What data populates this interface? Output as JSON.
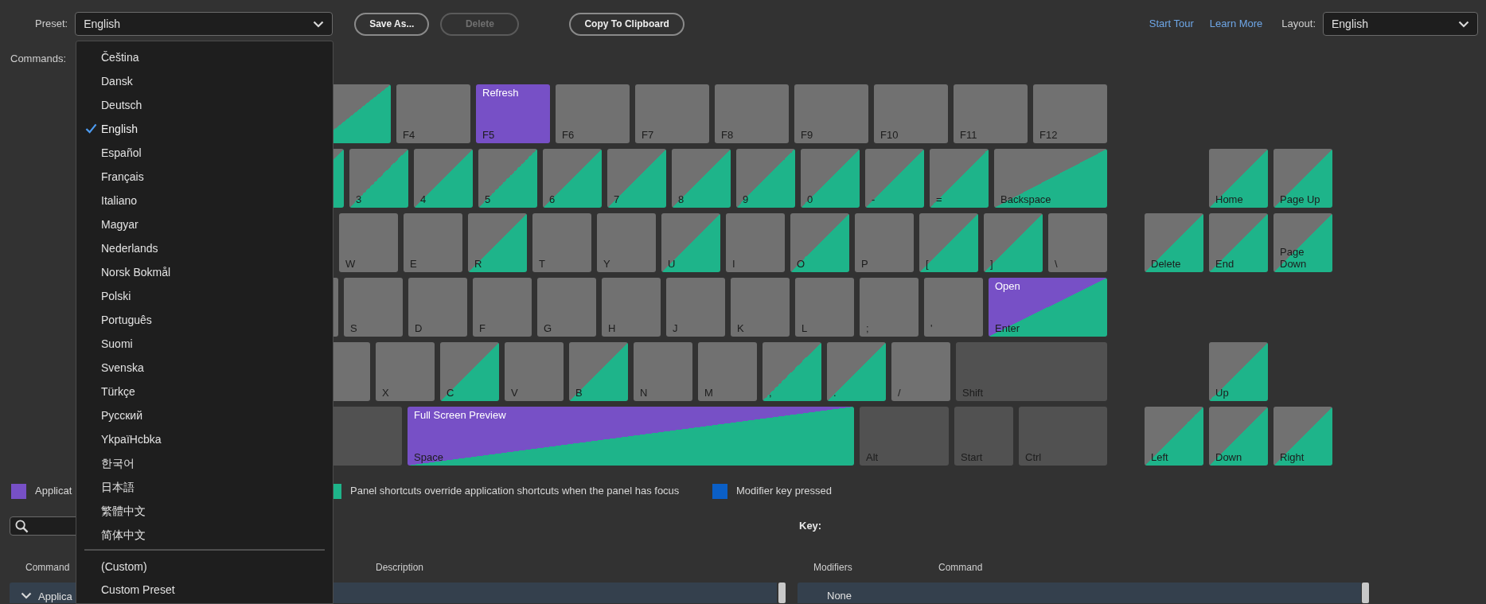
{
  "toolbar": {
    "preset_label": "Preset:",
    "preset_value": "English",
    "buttons": [
      {
        "label": "Save As...",
        "disabled": false
      },
      {
        "label": "Delete",
        "disabled": true
      },
      {
        "label": "Copy To Clipboard",
        "disabled": false
      }
    ],
    "links": [
      "Start Tour",
      "Learn More"
    ],
    "layout_label": "Layout:",
    "layout_value": "English"
  },
  "commands_label": "Commands:",
  "keyboard": {
    "rows": [
      {
        "keys": [
          {
            "kind": "key",
            "app_shortcut": false,
            "panel_shortcut": true
          },
          {
            "kind": "key",
            "label": "F4",
            "app_shortcut": false,
            "panel_shortcut": false
          },
          {
            "kind": "key",
            "label": "F5",
            "command": "Refresh",
            "app_shortcut": true,
            "panel_shortcut": false
          },
          {
            "kind": "key",
            "label": "F6",
            "app_shortcut": false,
            "panel_shortcut": false
          },
          {
            "kind": "key",
            "label": "F7",
            "app_shortcut": false,
            "panel_shortcut": false
          },
          {
            "kind": "key",
            "label": "F8",
            "app_shortcut": false,
            "panel_shortcut": false
          },
          {
            "kind": "key",
            "label": "F9",
            "app_shortcut": false,
            "panel_shortcut": false
          },
          {
            "kind": "key",
            "label": "F10",
            "app_shortcut": false,
            "panel_shortcut": false
          },
          {
            "kind": "key",
            "label": "F11",
            "app_shortcut": false,
            "panel_shortcut": false
          },
          {
            "kind": "key",
            "label": "F12",
            "app_shortcut": false,
            "panel_shortcut": false
          }
        ],
        "nav_keys": []
      },
      {
        "keys": [
          {
            "kind": "key",
            "app_shortcut": false,
            "panel_shortcut": true
          },
          {
            "kind": "key",
            "label": "3",
            "app_shortcut": false,
            "panel_shortcut": true
          },
          {
            "kind": "key",
            "label": "4",
            "app_shortcut": false,
            "panel_shortcut": true
          },
          {
            "kind": "key",
            "label": "5",
            "app_shortcut": false,
            "panel_shortcut": true
          },
          {
            "kind": "key",
            "label": "6",
            "app_shortcut": false,
            "panel_shortcut": true
          },
          {
            "kind": "key",
            "label": "7",
            "app_shortcut": false,
            "panel_shortcut": true
          },
          {
            "kind": "key",
            "label": "8",
            "app_shortcut": false,
            "panel_shortcut": true
          },
          {
            "kind": "key",
            "label": "9",
            "app_shortcut": false,
            "panel_shortcut": true
          },
          {
            "kind": "key",
            "label": "0",
            "app_shortcut": false,
            "panel_shortcut": true
          },
          {
            "kind": "key",
            "label": "-",
            "app_shortcut": false,
            "panel_shortcut": true
          },
          {
            "kind": "key",
            "label": "=",
            "app_shortcut": false,
            "panel_shortcut": true
          },
          {
            "kind": "key",
            "label": "Backspace",
            "app_shortcut": false,
            "panel_shortcut": true
          }
        ],
        "nav_keys": [
          {
            "kind": "key",
            "label": "Home",
            "app_shortcut": false,
            "panel_shortcut": true
          },
          {
            "kind": "key",
            "label": "Page Up",
            "app_shortcut": false,
            "panel_shortcut": true
          }
        ]
      },
      {
        "keys": [
          {
            "kind": "key",
            "label": "W",
            "app_shortcut": false,
            "panel_shortcut": false
          },
          {
            "kind": "key",
            "label": "E",
            "app_shortcut": false,
            "panel_shortcut": false
          },
          {
            "kind": "key",
            "label": "R",
            "app_shortcut": false,
            "panel_shortcut": true
          },
          {
            "kind": "key",
            "label": "T",
            "app_shortcut": false,
            "panel_shortcut": false
          },
          {
            "kind": "key",
            "label": "Y",
            "app_shortcut": false,
            "panel_shortcut": false
          },
          {
            "kind": "key",
            "label": "U",
            "app_shortcut": false,
            "panel_shortcut": true
          },
          {
            "kind": "key",
            "label": "I",
            "app_shortcut": false,
            "panel_shortcut": false
          },
          {
            "kind": "key",
            "label": "O",
            "app_shortcut": false,
            "panel_shortcut": true
          },
          {
            "kind": "key",
            "label": "P",
            "app_shortcut": false,
            "panel_shortcut": false
          },
          {
            "kind": "key",
            "label": "[",
            "app_shortcut": false,
            "panel_shortcut": true
          },
          {
            "kind": "key",
            "label": "]",
            "app_shortcut": false,
            "panel_shortcut": true
          },
          {
            "kind": "key",
            "label": "\\",
            "app_shortcut": false,
            "panel_shortcut": false
          }
        ],
        "nav_keys": [
          {
            "kind": "key",
            "label": "Delete",
            "app_shortcut": false,
            "panel_shortcut": true
          },
          {
            "kind": "key",
            "label": "End",
            "app_shortcut": false,
            "panel_shortcut": true
          },
          {
            "kind": "key",
            "label": "Page Down",
            "app_shortcut": false,
            "panel_shortcut": true
          }
        ]
      },
      {
        "keys": [
          {
            "kind": "key",
            "app_shortcut": false,
            "panel_shortcut": false
          },
          {
            "kind": "key",
            "label": "S",
            "app_shortcut": false,
            "panel_shortcut": false
          },
          {
            "kind": "key",
            "label": "D",
            "app_shortcut": false,
            "panel_shortcut": false
          },
          {
            "kind": "key",
            "label": "F",
            "app_shortcut": false,
            "panel_shortcut": false
          },
          {
            "kind": "key",
            "label": "G",
            "app_shortcut": false,
            "panel_shortcut": false
          },
          {
            "kind": "key",
            "label": "H",
            "app_shortcut": false,
            "panel_shortcut": false
          },
          {
            "kind": "key",
            "label": "J",
            "app_shortcut": false,
            "panel_shortcut": false
          },
          {
            "kind": "key",
            "label": "K",
            "app_shortcut": false,
            "panel_shortcut": false
          },
          {
            "kind": "key",
            "label": "L",
            "app_shortcut": false,
            "panel_shortcut": false
          },
          {
            "kind": "key",
            "label": ";",
            "app_shortcut": false,
            "panel_shortcut": false
          },
          {
            "kind": "key",
            "label": "'",
            "app_shortcut": false,
            "panel_shortcut": false
          },
          {
            "kind": "key",
            "label": "Enter",
            "command": "Open",
            "app_shortcut": true,
            "panel_shortcut": true
          }
        ],
        "nav_keys": []
      },
      {
        "keys": [
          {
            "kind": "key",
            "app_shortcut": false,
            "panel_shortcut": false
          },
          {
            "kind": "key",
            "label": "X",
            "app_shortcut": false,
            "panel_shortcut": false
          },
          {
            "kind": "key",
            "label": "C",
            "app_shortcut": false,
            "panel_shortcut": true
          },
          {
            "kind": "key",
            "label": "V",
            "app_shortcut": false,
            "panel_shortcut": false
          },
          {
            "kind": "key",
            "label": "B",
            "app_shortcut": false,
            "panel_shortcut": true
          },
          {
            "kind": "key",
            "label": "N",
            "app_shortcut": false,
            "panel_shortcut": false
          },
          {
            "kind": "key",
            "label": "M",
            "app_shortcut": false,
            "panel_shortcut": false
          },
          {
            "kind": "key",
            "label": ",",
            "app_shortcut": false,
            "panel_shortcut": true
          },
          {
            "kind": "key",
            "label": ".",
            "app_shortcut": false,
            "panel_shortcut": true
          },
          {
            "kind": "key",
            "label": "/",
            "app_shortcut": false,
            "panel_shortcut": false
          },
          {
            "kind": "modifier",
            "label": "Shift"
          }
        ],
        "nav_keys": [
          {
            "kind": "key",
            "label": "Up",
            "app_shortcut": false,
            "panel_shortcut": true
          }
        ]
      },
      {
        "keys": [
          {
            "kind": "modifier"
          },
          {
            "kind": "key",
            "label": "Space",
            "command": "Full Screen Preview",
            "app_shortcut": true,
            "panel_shortcut": true
          },
          {
            "kind": "modifier",
            "label": "Alt"
          },
          {
            "kind": "modifier",
            "label": "Start"
          },
          {
            "kind": "modifier",
            "label": "Ctrl"
          }
        ],
        "nav_keys": [
          {
            "kind": "key",
            "label": "Left",
            "app_shortcut": false,
            "panel_shortcut": true
          },
          {
            "kind": "key",
            "label": "Down",
            "app_shortcut": false,
            "panel_shortcut": true
          },
          {
            "kind": "key",
            "label": "Right",
            "app_shortcut": false,
            "panel_shortcut": true
          }
        ]
      }
    ]
  },
  "legend": [
    {
      "label": "Applicat",
      "color": "#7750c6"
    },
    {
      "label": "Panel shortcuts override application shortcuts when the panel has focus",
      "color": "#1eb48a"
    },
    {
      "label": "Modifier key pressed",
      "color": "#0b5fc6"
    }
  ],
  "key_label": "Key:",
  "commands_table": {
    "columns": [
      "Command",
      "Description"
    ],
    "rows": [
      {
        "label": "Applica",
        "expanded": true
      }
    ]
  },
  "keys_table": {
    "columns": [
      "Modifiers",
      "Command"
    ],
    "rows": [
      {
        "modifiers": "None"
      }
    ]
  },
  "preset_menu": {
    "items": [
      {
        "label": "Čeština",
        "selected": false
      },
      {
        "label": "Dansk",
        "selected": false
      },
      {
        "label": "Deutsch",
        "selected": false
      },
      {
        "label": "English",
        "selected": true
      },
      {
        "label": "Español",
        "selected": false
      },
      {
        "label": "Français",
        "selected": false
      },
      {
        "label": "Italiano",
        "selected": false
      },
      {
        "label": "Magyar",
        "selected": false
      },
      {
        "label": "Nederlands",
        "selected": false
      },
      {
        "label": "Norsk Bokmål",
        "selected": false
      },
      {
        "label": "Polski",
        "selected": false
      },
      {
        "label": "Português",
        "selected": false
      },
      {
        "label": "Suomi",
        "selected": false
      },
      {
        "label": "Svenska",
        "selected": false
      },
      {
        "label": "Türkçe",
        "selected": false
      },
      {
        "label": "Русский",
        "selected": false
      },
      {
        "label": "YkpaïHcbka",
        "selected": false
      },
      {
        "label": "한국어",
        "selected": false
      },
      {
        "label": "日本語",
        "selected": false
      },
      {
        "label": "繁體中文",
        "selected": false
      },
      {
        "label": "简体中文",
        "selected": false
      }
    ],
    "custom_items": [
      {
        "label": "(Custom)",
        "selected": false
      },
      {
        "label": "Custom Preset",
        "selected": false
      }
    ]
  }
}
